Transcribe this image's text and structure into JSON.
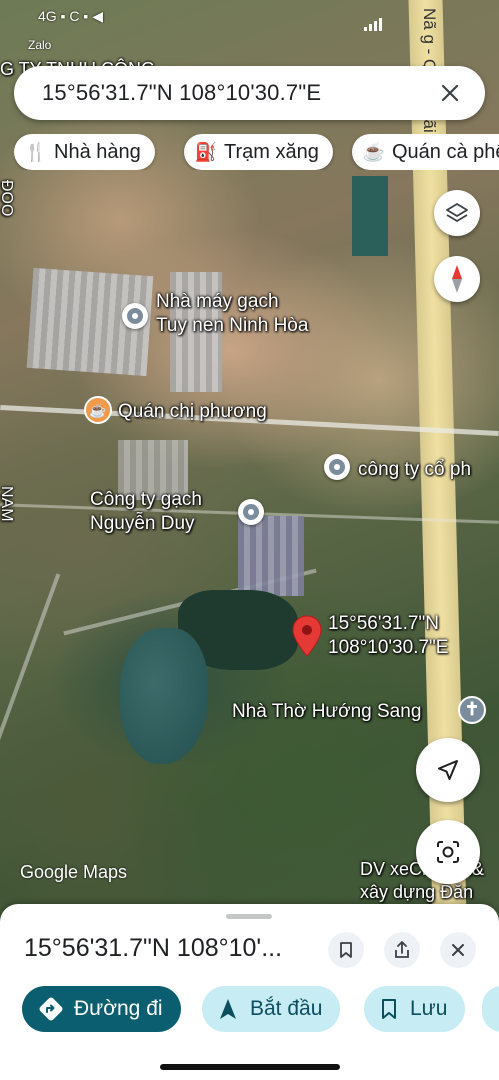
{
  "status_bar": {
    "left_text": "4G ▪ C ▪ ◀",
    "zalo_label": "Zalo"
  },
  "map": {
    "partial_top_label": "G TY TNHH CÔNG",
    "road_label": "Nã g - Qu ng gãi",
    "left_edge_label_1": "ĐOO",
    "left_edge_label_2": "NAM",
    "labels": {
      "factory_1": "Nhà máy gạch\nTuy nen Ninh Hòa",
      "cafe": "Quán chị phương",
      "company_right": "công ty cổ ph",
      "factory_2": "Công ty gạch\nNguyễn Duy",
      "pin_coords": "15°56'31.7\"N\n108°10'30.7\"E",
      "church": "Nhà Thờ Hướng Sang",
      "dv": "DV xeCh...em&\nxây dựng Đăn"
    },
    "watermark": "Google Maps"
  },
  "search": {
    "query": "15°56'31.7\"N 108°10'30.7\"E"
  },
  "chips": [
    {
      "icon": "restaurant-icon",
      "label": "Nhà hàng"
    },
    {
      "icon": "gas-station-icon",
      "label": "Trạm xăng"
    },
    {
      "icon": "coffee-icon",
      "label": "Quán cà phê"
    }
  ],
  "sheet": {
    "title": "15°56'31.7\"N 108°10'...",
    "actions": [
      {
        "icon": "directions-icon",
        "label": "Đường đi"
      },
      {
        "icon": "navigation-arrow-icon",
        "label": "Bắt đầu"
      },
      {
        "icon": "bookmark-icon",
        "label": "Lưu"
      }
    ]
  },
  "colors": {
    "primary_button": "#0b5e6f",
    "secondary_button": "#c8ecf3",
    "pin": "#e53935"
  }
}
